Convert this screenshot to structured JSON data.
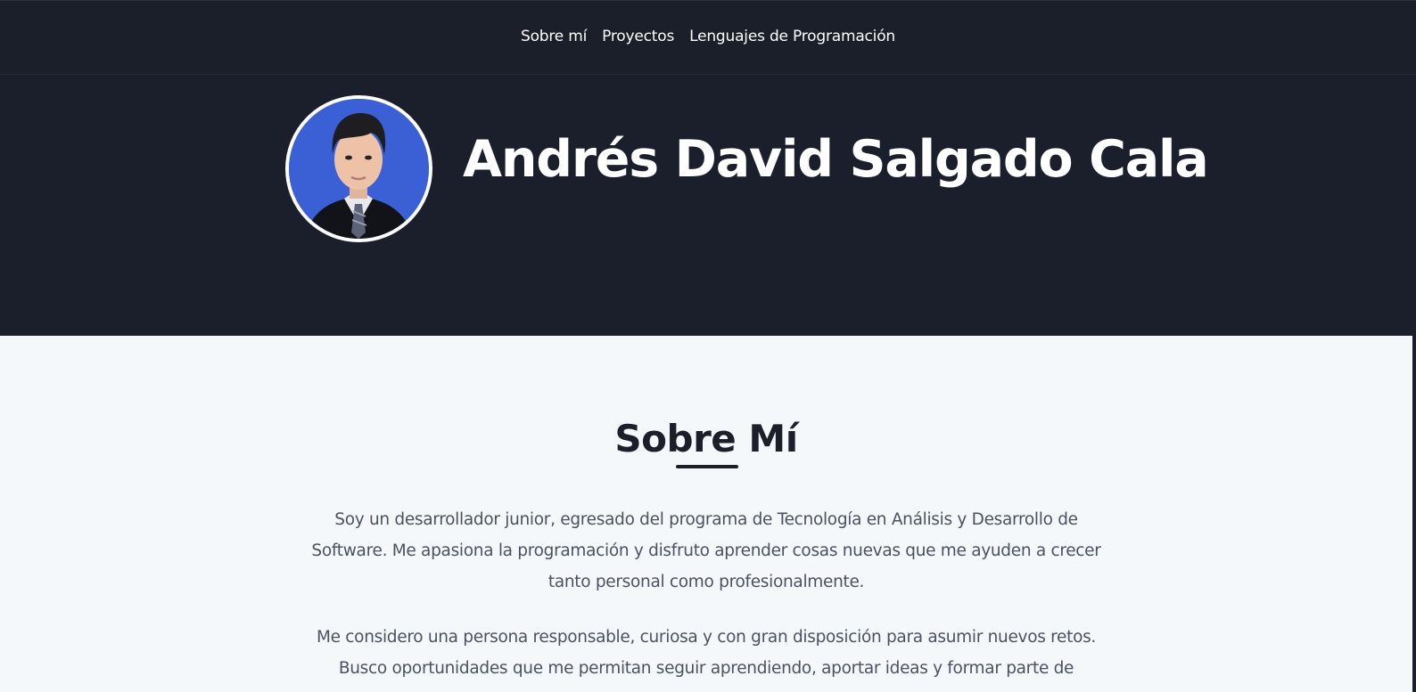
{
  "nav": {
    "items": [
      {
        "label": "Sobre mí"
      },
      {
        "label": "Proyectos"
      },
      {
        "label": "Lenguajes de Programación"
      }
    ]
  },
  "hero": {
    "name": "Andrés David Salgado Cala"
  },
  "about": {
    "title": "Sobre Mí",
    "paragraphs": [
      "Soy un desarrollador junior, egresado del programa de Tecnología en Análisis y Desarrollo de Software. Me apasiona la programación y disfruto aprender cosas nuevas que me ayuden a crecer tanto personal como profesionalmente.",
      "Me considero una persona responsable, curiosa y con gran disposición para asumir nuevos retos. Busco oportunidades que me permitan seguir aprendiendo, aportar ideas y formar parte de"
    ]
  },
  "colors": {
    "navbar_bg": "#1b1f29",
    "hero_bg": "#1b1f2b",
    "about_bg": "#f5f8fb",
    "avatar_bg": "#3b5fd4",
    "heading": "#1b1f29",
    "body_text": "#4a5261"
  }
}
